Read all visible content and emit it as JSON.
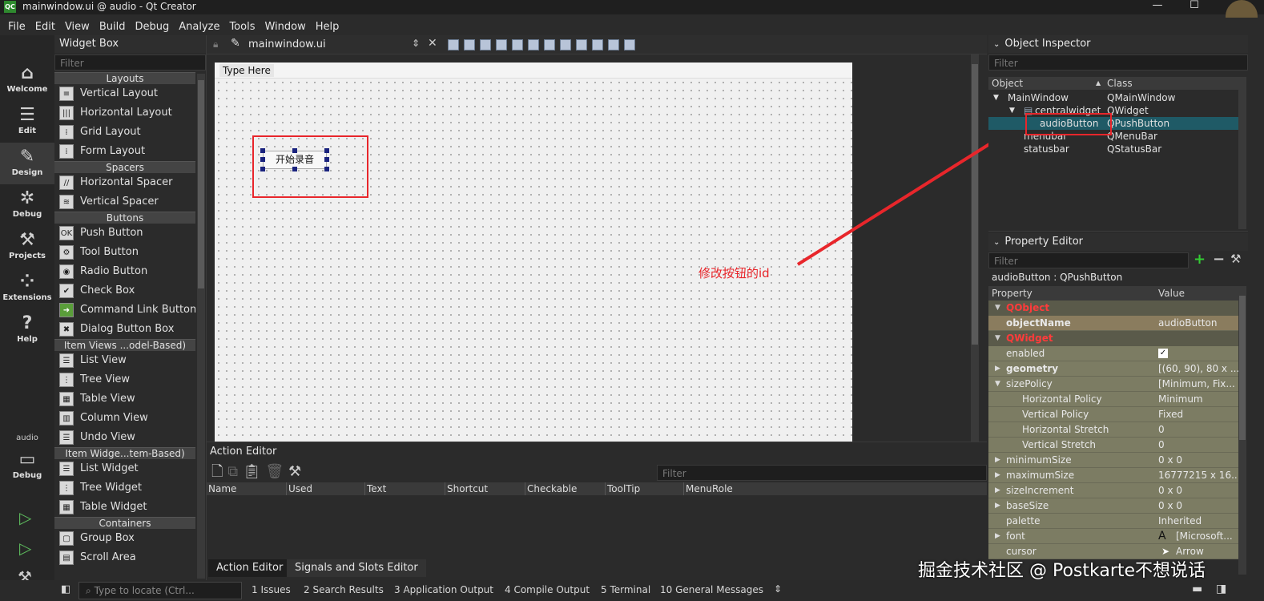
{
  "window": {
    "title": "mainwindow.ui @ audio - Qt Creator",
    "app_badge": "QC",
    "minimize": "—",
    "maximize": "☐"
  },
  "menu": [
    "File",
    "Edit",
    "View",
    "Build",
    "Debug",
    "Analyze",
    "Tools",
    "Window",
    "Help"
  ],
  "modes": [
    {
      "label": "Welcome",
      "icon": "home-icon"
    },
    {
      "label": "Edit",
      "icon": "edit-icon"
    },
    {
      "label": "Design",
      "icon": "design-icon"
    },
    {
      "label": "Debug",
      "icon": "bug-icon"
    },
    {
      "label": "Projects",
      "icon": "wrench-icon"
    },
    {
      "label": "Extensions",
      "icon": "extensions-icon"
    },
    {
      "label": "Help",
      "icon": "help-icon"
    }
  ],
  "kit": {
    "project": "audio",
    "label": "Debug"
  },
  "widget_box": {
    "title": "Widget Box",
    "filter_placeholder": "Filter",
    "categories": [
      {
        "name": "Layouts",
        "items": [
          "Vertical Layout",
          "Horizontal Layout",
          "Grid Layout",
          "Form Layout"
        ]
      },
      {
        "name": "Spacers",
        "items": [
          "Horizontal Spacer",
          "Vertical Spacer"
        ]
      },
      {
        "name": "Buttons",
        "items": [
          "Push Button",
          "Tool Button",
          "Radio Button",
          "Check Box",
          "Command Link Button",
          "Dialog Button Box"
        ]
      },
      {
        "name": "Item Views ...odel-Based)",
        "items": [
          "List View",
          "Tree View",
          "Table View",
          "Column View",
          "Undo View"
        ]
      },
      {
        "name": "Item Widge...tem-Based)",
        "items": [
          "List Widget",
          "Tree Widget",
          "Table Widget"
        ]
      },
      {
        "name": "Containers",
        "items": [
          "Group Box",
          "Scroll Area"
        ]
      }
    ]
  },
  "editor": {
    "file_name": "mainwindow.ui",
    "menu_placeholder": "Type Here",
    "button_text": "开始录音"
  },
  "annotation": {
    "text": "修改按钮的id",
    "color": "#e8262b"
  },
  "action_editor": {
    "title": "Action Editor",
    "filter_placeholder": "Filter",
    "columns": [
      "Name",
      "Used",
      "Text",
      "Shortcut",
      "Checkable",
      "ToolTip",
      "MenuRole"
    ],
    "tabs": [
      "Action Editor",
      "Signals and Slots Editor"
    ]
  },
  "object_inspector": {
    "title": "Object Inspector",
    "filter_placeholder": "Filter",
    "columns": [
      "Object",
      "Class"
    ],
    "rows": [
      {
        "object": "MainWindow",
        "class": "QMainWindow"
      },
      {
        "object": "centralwidget",
        "class": "QWidget"
      },
      {
        "object": "audioButton",
        "class": "QPushButton"
      },
      {
        "object": "menubar",
        "class": "QMenuBar"
      },
      {
        "object": "statusbar",
        "class": "QStatusBar"
      }
    ]
  },
  "property_editor": {
    "title": "Property Editor",
    "filter_placeholder": "Filter",
    "context": "audioButton : QPushButton",
    "columns": [
      "Property",
      "Value"
    ],
    "cat_qobject": "QObject",
    "cat_qwidget": "QWidget",
    "rows": [
      {
        "name": "objectName",
        "value": "audioButton"
      },
      {
        "name": "enabled",
        "value": "✓"
      },
      {
        "name": "geometry",
        "value": "[(60, 90), 80 x ..."
      },
      {
        "name": "sizePolicy",
        "value": "[Minimum, Fix..."
      },
      {
        "name": "Horizontal Policy",
        "value": "Minimum"
      },
      {
        "name": "Vertical Policy",
        "value": "Fixed"
      },
      {
        "name": "Horizontal Stretch",
        "value": "0"
      },
      {
        "name": "Vertical Stretch",
        "value": "0"
      },
      {
        "name": "minimumSize",
        "value": "0 x 0"
      },
      {
        "name": "maximumSize",
        "value": "16777215 x 16..."
      },
      {
        "name": "sizeIncrement",
        "value": "0 x 0"
      },
      {
        "name": "baseSize",
        "value": "0 x 0"
      },
      {
        "name": "palette",
        "value": "Inherited"
      },
      {
        "name": "font",
        "value": "[Microsoft..."
      },
      {
        "name": "cursor",
        "value": "Arrow"
      }
    ]
  },
  "statusbar": {
    "locate_placeholder": "Type to locate (Ctrl...",
    "tabs": [
      "1  Issues",
      "2  Search Results",
      "3  Application Output",
      "4  Compile Output",
      "5  Terminal",
      "10  General Messages"
    ]
  },
  "watermark": "掘金技术社区 @ Postkarte不想说话"
}
